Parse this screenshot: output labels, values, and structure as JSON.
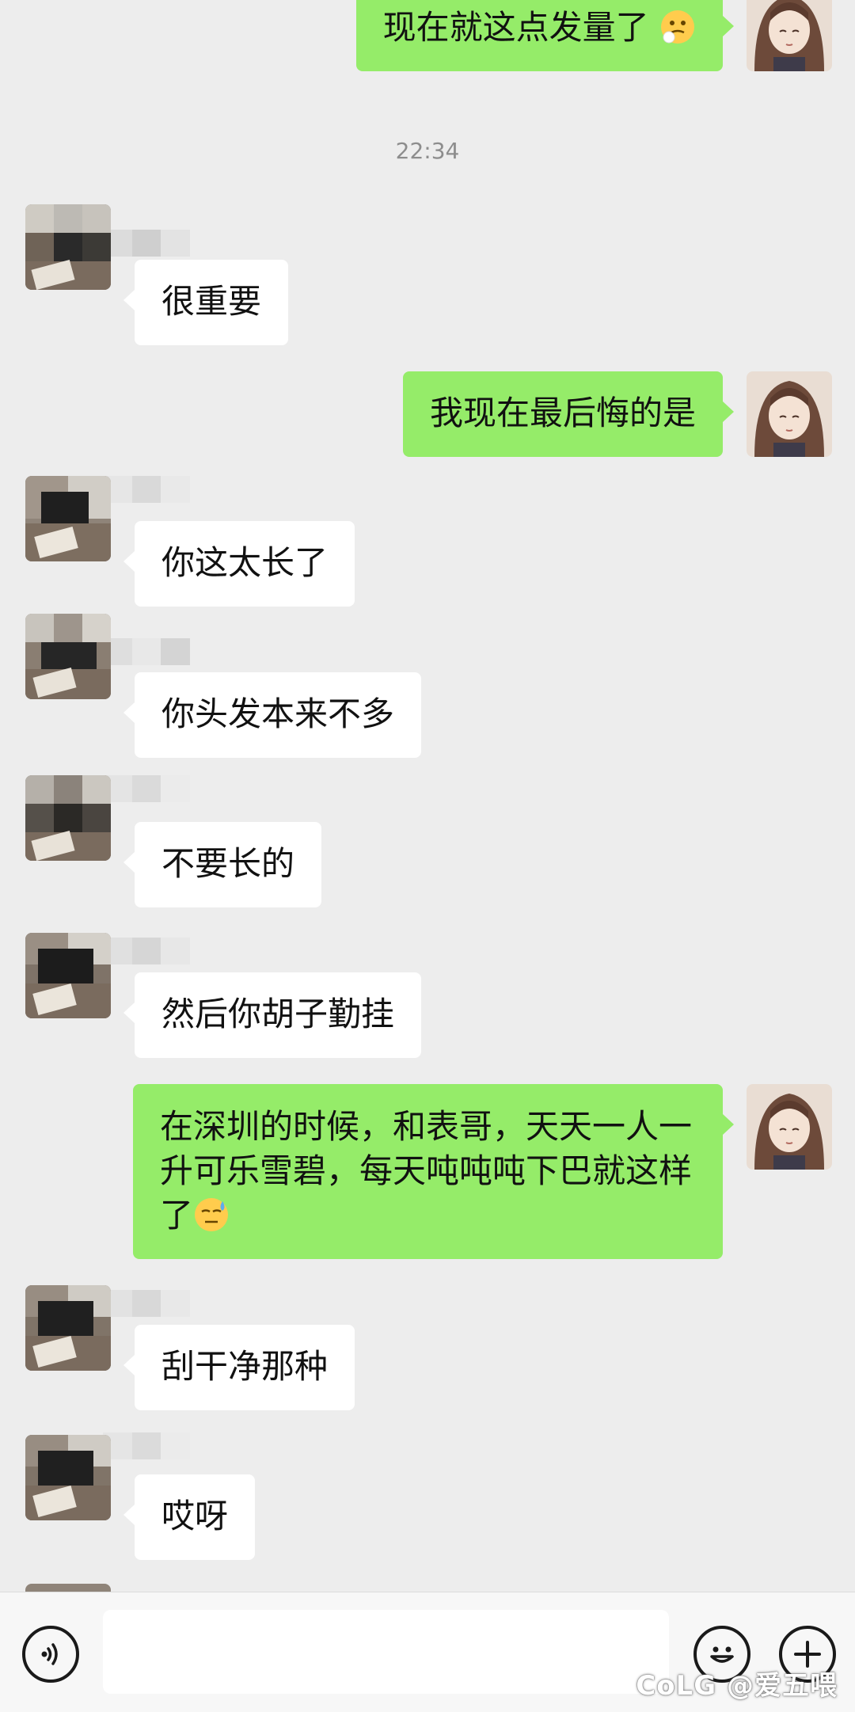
{
  "chat": {
    "timestamp": "22:34",
    "messages": [
      {
        "side": "right",
        "text": "现在就这点发量了"
      },
      {
        "side": "left",
        "text": "很重要"
      },
      {
        "side": "right",
        "text": "我现在最后悔的是"
      },
      {
        "side": "left",
        "text": "你这太长了"
      },
      {
        "side": "left",
        "text": "你头发本来不多"
      },
      {
        "side": "left",
        "text": "不要长的"
      },
      {
        "side": "left",
        "text": "然后你胡子勤挂"
      },
      {
        "side": "right",
        "text": "在深圳的时候，和表哥，天天一人一升可乐雪碧，每天吨吨吨下巴就这样了"
      },
      {
        "side": "left",
        "text": "刮干净那种"
      },
      {
        "side": "left",
        "text": "哎呀"
      }
    ]
  },
  "emoji": {
    "msg0": "thinking-face-emoji",
    "msg7": "sweat-face-emoji"
  },
  "input_bar": {
    "value": "",
    "placeholder": ""
  },
  "icons": {
    "voice": "voice-icon",
    "emoji": "emoji-icon",
    "plus": "plus-icon"
  },
  "watermark": "CoLG @爱五喂",
  "colors": {
    "background": "#ededed",
    "sent_bubble": "#95ec69",
    "received_bubble": "#ffffff"
  }
}
